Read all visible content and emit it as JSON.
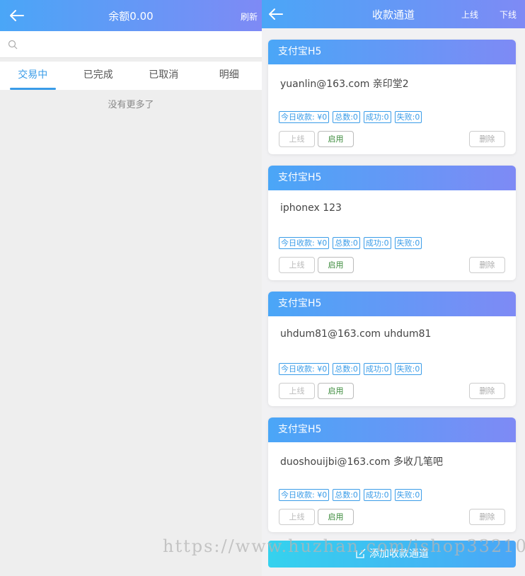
{
  "left": {
    "header": {
      "title": "余额0.00",
      "refresh_label": "刷新"
    },
    "search": {
      "placeholder": ""
    },
    "tabs": [
      {
        "label": "交易中",
        "active": true
      },
      {
        "label": "已完成",
        "active": false
      },
      {
        "label": "已取消",
        "active": false
      },
      {
        "label": "明细",
        "active": false
      }
    ],
    "empty_text": "没有更多了"
  },
  "right": {
    "header": {
      "title": "收款通道",
      "online_label": "上线",
      "offline_label": "下线"
    },
    "cards": [
      {
        "type": "支付宝H5",
        "name": "yuanlin@163.com 亲印堂2",
        "today": "今日收款: ¥0",
        "total": "总数:0",
        "success": "成功:0",
        "fail": "失败:0",
        "online_btn": "上线",
        "enable_btn": "启用",
        "delete_btn": "删除"
      },
      {
        "type": "支付宝H5",
        "name": "iphonex 123",
        "today": "今日收款: ¥0",
        "total": "总数:0",
        "success": "成功:0",
        "fail": "失败:0",
        "online_btn": "上线",
        "enable_btn": "启用",
        "delete_btn": "删除"
      },
      {
        "type": "支付宝H5",
        "name": "uhdum81@163.com uhdum81",
        "today": "今日收款: ¥0",
        "total": "总数:0",
        "success": "成功:0",
        "fail": "失败:0",
        "online_btn": "上线",
        "enable_btn": "启用",
        "delete_btn": "删除"
      },
      {
        "type": "支付宝H5",
        "name": "duoshouijbi@163.com 多收几笔吧",
        "today": "今日收款: ¥0",
        "total": "总数:0",
        "success": "成功:0",
        "fail": "失败:0",
        "online_btn": "上线",
        "enable_btn": "启用",
        "delete_btn": "删除"
      }
    ],
    "add_button_label": "添加收款通道"
  },
  "watermark": "https://www.huzhan.com/ishop33210",
  "colors": {
    "accent": "#3a9ce8",
    "header_start": "#4aa6f7",
    "header_end": "#7e8af5",
    "enable_text": "#3a8a3a"
  }
}
